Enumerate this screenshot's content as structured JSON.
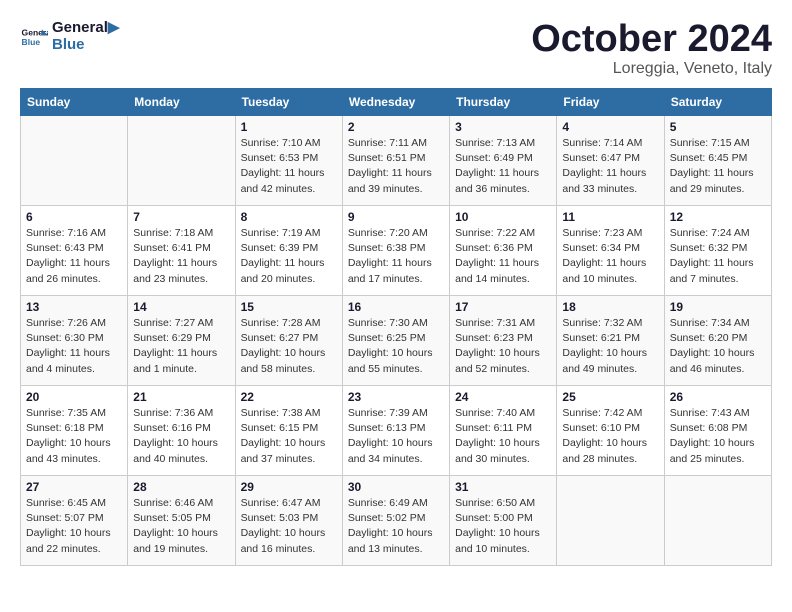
{
  "logo": {
    "text_general": "General",
    "text_blue": "Blue"
  },
  "title": "October 2024",
  "location": "Loreggia, Veneto, Italy",
  "days_of_week": [
    "Sunday",
    "Monday",
    "Tuesday",
    "Wednesday",
    "Thursday",
    "Friday",
    "Saturday"
  ],
  "weeks": [
    [
      {
        "day": "",
        "info": ""
      },
      {
        "day": "",
        "info": ""
      },
      {
        "day": "1",
        "info": "Sunrise: 7:10 AM\nSunset: 6:53 PM\nDaylight: 11 hours and 42 minutes."
      },
      {
        "day": "2",
        "info": "Sunrise: 7:11 AM\nSunset: 6:51 PM\nDaylight: 11 hours and 39 minutes."
      },
      {
        "day": "3",
        "info": "Sunrise: 7:13 AM\nSunset: 6:49 PM\nDaylight: 11 hours and 36 minutes."
      },
      {
        "day": "4",
        "info": "Sunrise: 7:14 AM\nSunset: 6:47 PM\nDaylight: 11 hours and 33 minutes."
      },
      {
        "day": "5",
        "info": "Sunrise: 7:15 AM\nSunset: 6:45 PM\nDaylight: 11 hours and 29 minutes."
      }
    ],
    [
      {
        "day": "6",
        "info": "Sunrise: 7:16 AM\nSunset: 6:43 PM\nDaylight: 11 hours and 26 minutes."
      },
      {
        "day": "7",
        "info": "Sunrise: 7:18 AM\nSunset: 6:41 PM\nDaylight: 11 hours and 23 minutes."
      },
      {
        "day": "8",
        "info": "Sunrise: 7:19 AM\nSunset: 6:39 PM\nDaylight: 11 hours and 20 minutes."
      },
      {
        "day": "9",
        "info": "Sunrise: 7:20 AM\nSunset: 6:38 PM\nDaylight: 11 hours and 17 minutes."
      },
      {
        "day": "10",
        "info": "Sunrise: 7:22 AM\nSunset: 6:36 PM\nDaylight: 11 hours and 14 minutes."
      },
      {
        "day": "11",
        "info": "Sunrise: 7:23 AM\nSunset: 6:34 PM\nDaylight: 11 hours and 10 minutes."
      },
      {
        "day": "12",
        "info": "Sunrise: 7:24 AM\nSunset: 6:32 PM\nDaylight: 11 hours and 7 minutes."
      }
    ],
    [
      {
        "day": "13",
        "info": "Sunrise: 7:26 AM\nSunset: 6:30 PM\nDaylight: 11 hours and 4 minutes."
      },
      {
        "day": "14",
        "info": "Sunrise: 7:27 AM\nSunset: 6:29 PM\nDaylight: 11 hours and 1 minute."
      },
      {
        "day": "15",
        "info": "Sunrise: 7:28 AM\nSunset: 6:27 PM\nDaylight: 10 hours and 58 minutes."
      },
      {
        "day": "16",
        "info": "Sunrise: 7:30 AM\nSunset: 6:25 PM\nDaylight: 10 hours and 55 minutes."
      },
      {
        "day": "17",
        "info": "Sunrise: 7:31 AM\nSunset: 6:23 PM\nDaylight: 10 hours and 52 minutes."
      },
      {
        "day": "18",
        "info": "Sunrise: 7:32 AM\nSunset: 6:21 PM\nDaylight: 10 hours and 49 minutes."
      },
      {
        "day": "19",
        "info": "Sunrise: 7:34 AM\nSunset: 6:20 PM\nDaylight: 10 hours and 46 minutes."
      }
    ],
    [
      {
        "day": "20",
        "info": "Sunrise: 7:35 AM\nSunset: 6:18 PM\nDaylight: 10 hours and 43 minutes."
      },
      {
        "day": "21",
        "info": "Sunrise: 7:36 AM\nSunset: 6:16 PM\nDaylight: 10 hours and 40 minutes."
      },
      {
        "day": "22",
        "info": "Sunrise: 7:38 AM\nSunset: 6:15 PM\nDaylight: 10 hours and 37 minutes."
      },
      {
        "day": "23",
        "info": "Sunrise: 7:39 AM\nSunset: 6:13 PM\nDaylight: 10 hours and 34 minutes."
      },
      {
        "day": "24",
        "info": "Sunrise: 7:40 AM\nSunset: 6:11 PM\nDaylight: 10 hours and 30 minutes."
      },
      {
        "day": "25",
        "info": "Sunrise: 7:42 AM\nSunset: 6:10 PM\nDaylight: 10 hours and 28 minutes."
      },
      {
        "day": "26",
        "info": "Sunrise: 7:43 AM\nSunset: 6:08 PM\nDaylight: 10 hours and 25 minutes."
      }
    ],
    [
      {
        "day": "27",
        "info": "Sunrise: 6:45 AM\nSunset: 5:07 PM\nDaylight: 10 hours and 22 minutes."
      },
      {
        "day": "28",
        "info": "Sunrise: 6:46 AM\nSunset: 5:05 PM\nDaylight: 10 hours and 19 minutes."
      },
      {
        "day": "29",
        "info": "Sunrise: 6:47 AM\nSunset: 5:03 PM\nDaylight: 10 hours and 16 minutes."
      },
      {
        "day": "30",
        "info": "Sunrise: 6:49 AM\nSunset: 5:02 PM\nDaylight: 10 hours and 13 minutes."
      },
      {
        "day": "31",
        "info": "Sunrise: 6:50 AM\nSunset: 5:00 PM\nDaylight: 10 hours and 10 minutes."
      },
      {
        "day": "",
        "info": ""
      },
      {
        "day": "",
        "info": ""
      }
    ]
  ]
}
